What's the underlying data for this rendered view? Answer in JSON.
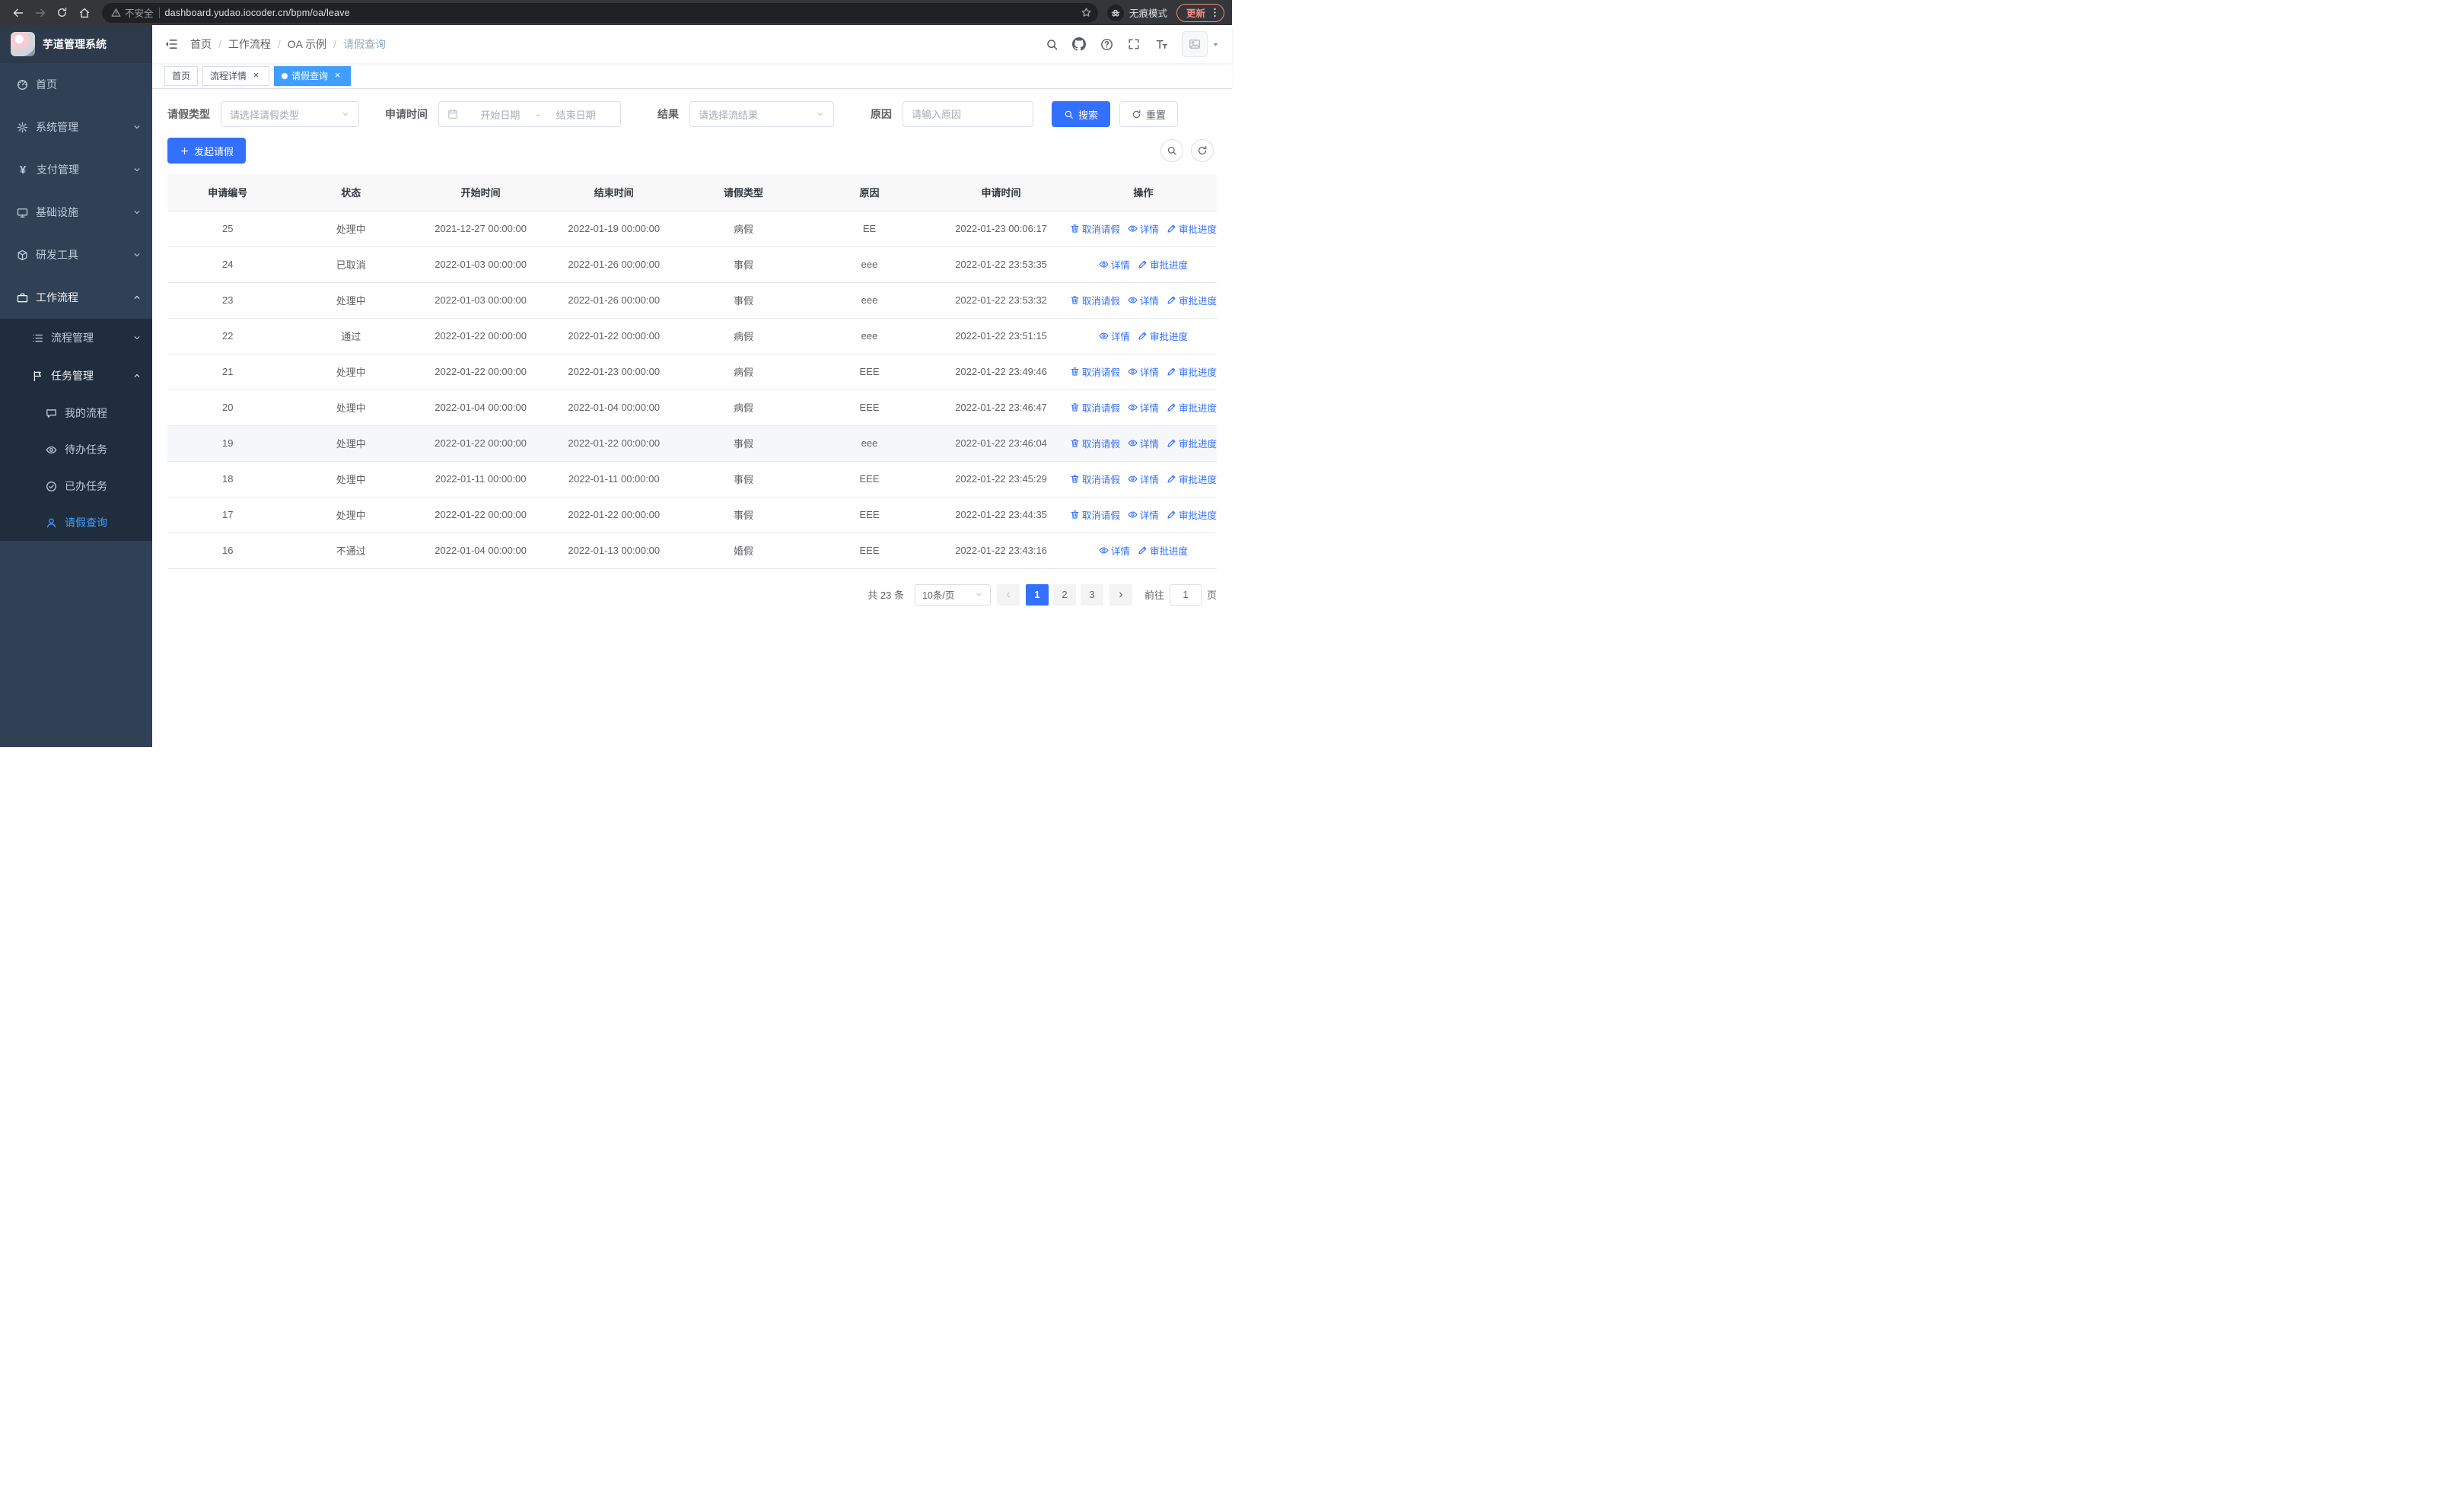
{
  "theme": {
    "primary": "#3370ff",
    "sidebar_active": "#409eff",
    "tab_active": "#409eff",
    "sidebar_bg": "#304156",
    "submenu_bg": "#1f2d3d"
  },
  "browser": {
    "security_label": "不安全",
    "url": "dashboard.yudao.iocoder.cn/bpm/oa/leave",
    "incognito_label": "无痕模式",
    "update_label": "更新"
  },
  "app": {
    "title": "芋道管理系统"
  },
  "sidebar": {
    "items": [
      {
        "name": "home",
        "label": "首页",
        "icon": "dashboard-icon",
        "level": 1
      },
      {
        "name": "system-management",
        "label": "系统管理",
        "icon": "gear-icon",
        "level": 1,
        "arrow": "down"
      },
      {
        "name": "payment-management",
        "label": "支付管理",
        "icon": "yen-icon",
        "level": 1,
        "arrow": "down"
      },
      {
        "name": "infrastructure",
        "label": "基础设施",
        "icon": "monitor-icon",
        "level": 1,
        "arrow": "down"
      },
      {
        "name": "dev-tools",
        "label": "研发工具",
        "icon": "cube-icon",
        "level": 1,
        "arrow": "down"
      },
      {
        "name": "workflow",
        "label": "工作流程",
        "icon": "briefcase-icon",
        "level": 1,
        "arrow": "up",
        "open": true
      },
      {
        "name": "process-management",
        "label": "流程管理",
        "icon": "list-icon",
        "level": 2,
        "arrow": "down",
        "dark": true
      },
      {
        "name": "task-management",
        "label": "任务管理",
        "icon": "flag-icon",
        "level": 2,
        "arrow": "up",
        "dark": true,
        "open": true
      },
      {
        "name": "my-process",
        "label": "我的流程",
        "icon": "chat-icon",
        "level": 3,
        "dark": true
      },
      {
        "name": "todo-tasks",
        "label": "待办任务",
        "icon": "eye-icon",
        "level": 3,
        "dark": true
      },
      {
        "name": "done-tasks",
        "label": "已办任务",
        "icon": "finished-icon",
        "level": 3,
        "dark": true
      },
      {
        "name": "leave-query",
        "label": "请假查询",
        "icon": "user-icon",
        "level": 3,
        "dark": true,
        "active": true
      }
    ]
  },
  "breadcrumb": [
    "首页",
    "工作流程",
    "OA 示例",
    "请假查询"
  ],
  "tabs": [
    {
      "name": "home",
      "label": "首页",
      "closable": false,
      "active": false
    },
    {
      "name": "process-detail",
      "label": "流程详情",
      "closable": true,
      "active": false
    },
    {
      "name": "leave-query",
      "label": "请假查询",
      "closable": true,
      "active": true
    }
  ],
  "filters": {
    "type_label": "请假类型",
    "type_placeholder": "请选择请假类型",
    "time_label": "申请时间",
    "start_placeholder": "开始日期",
    "range_separator": "-",
    "end_placeholder": "结束日期",
    "result_label": "结果",
    "result_placeholder": "请选择流结果",
    "reason_label": "原因",
    "reason_placeholder": "请输入原因",
    "search": "搜索",
    "reset": "重置"
  },
  "toolbar": {
    "create": "发起请假"
  },
  "table": {
    "columns": [
      "申请编号",
      "状态",
      "开始时间",
      "结束时间",
      "请假类型",
      "原因",
      "申请时间",
      "操作"
    ],
    "action_labels": {
      "cancel": "取消请假",
      "detail": "详情",
      "progress": "审批进度"
    },
    "action_icons": {
      "cancel": "delete-icon",
      "detail": "eye-icon",
      "progress": "edit-icon"
    },
    "rows": [
      {
        "id": "25",
        "status": "处理中",
        "start": "2021-12-27 00:00:00",
        "end": "2022-01-19 00:00:00",
        "type": "病假",
        "reason": "EE",
        "applied": "2022-01-23 00:06:17",
        "actions": [
          "cancel",
          "detail",
          "progress"
        ]
      },
      {
        "id": "24",
        "status": "已取消",
        "start": "2022-01-03 00:00:00",
        "end": "2022-01-26 00:00:00",
        "type": "事假",
        "reason": "eee",
        "applied": "2022-01-22 23:53:35",
        "actions": [
          "detail",
          "progress"
        ]
      },
      {
        "id": "23",
        "status": "处理中",
        "start": "2022-01-03 00:00:00",
        "end": "2022-01-26 00:00:00",
        "type": "事假",
        "reason": "eee",
        "applied": "2022-01-22 23:53:32",
        "actions": [
          "cancel",
          "detail",
          "progress"
        ]
      },
      {
        "id": "22",
        "status": "通过",
        "start": "2022-01-22 00:00:00",
        "end": "2022-01-22 00:00:00",
        "type": "病假",
        "reason": "eee",
        "applied": "2022-01-22 23:51:15",
        "actions": [
          "detail",
          "progress"
        ]
      },
      {
        "id": "21",
        "status": "处理中",
        "start": "2022-01-22 00:00:00",
        "end": "2022-01-23 00:00:00",
        "type": "病假",
        "reason": "EEE",
        "applied": "2022-01-22 23:49:46",
        "actions": [
          "cancel",
          "detail",
          "progress"
        ]
      },
      {
        "id": "20",
        "status": "处理中",
        "start": "2022-01-04 00:00:00",
        "end": "2022-01-04 00:00:00",
        "type": "病假",
        "reason": "EEE",
        "applied": "2022-01-22 23:46:47",
        "actions": [
          "cancel",
          "detail",
          "progress"
        ]
      },
      {
        "id": "19",
        "status": "处理中",
        "start": "2022-01-22 00:00:00",
        "end": "2022-01-22 00:00:00",
        "type": "事假",
        "reason": "eee",
        "applied": "2022-01-22 23:46:04",
        "actions": [
          "cancel",
          "detail",
          "progress"
        ],
        "hover": true
      },
      {
        "id": "18",
        "status": "处理中",
        "start": "2022-01-11 00:00:00",
        "end": "2022-01-11 00:00:00",
        "type": "事假",
        "reason": "EEE",
        "applied": "2022-01-22 23:45:29",
        "actions": [
          "cancel",
          "detail",
          "progress"
        ]
      },
      {
        "id": "17",
        "status": "处理中",
        "start": "2022-01-22 00:00:00",
        "end": "2022-01-22 00:00:00",
        "type": "事假",
        "reason": "EEE",
        "applied": "2022-01-22 23:44:35",
        "actions": [
          "cancel",
          "detail",
          "progress"
        ]
      },
      {
        "id": "16",
        "status": "不通过",
        "start": "2022-01-04 00:00:00",
        "end": "2022-01-13 00:00:00",
        "type": "婚假",
        "reason": "EEE",
        "applied": "2022-01-22 23:43:16",
        "actions": [
          "detail",
          "progress"
        ]
      }
    ]
  },
  "pagination": {
    "total": "共 23 条",
    "page_size": "10条/页",
    "pages": [
      "1",
      "2",
      "3"
    ],
    "current": "1",
    "goto_label": "前往",
    "goto_value": "1",
    "page_suffix": "页"
  }
}
